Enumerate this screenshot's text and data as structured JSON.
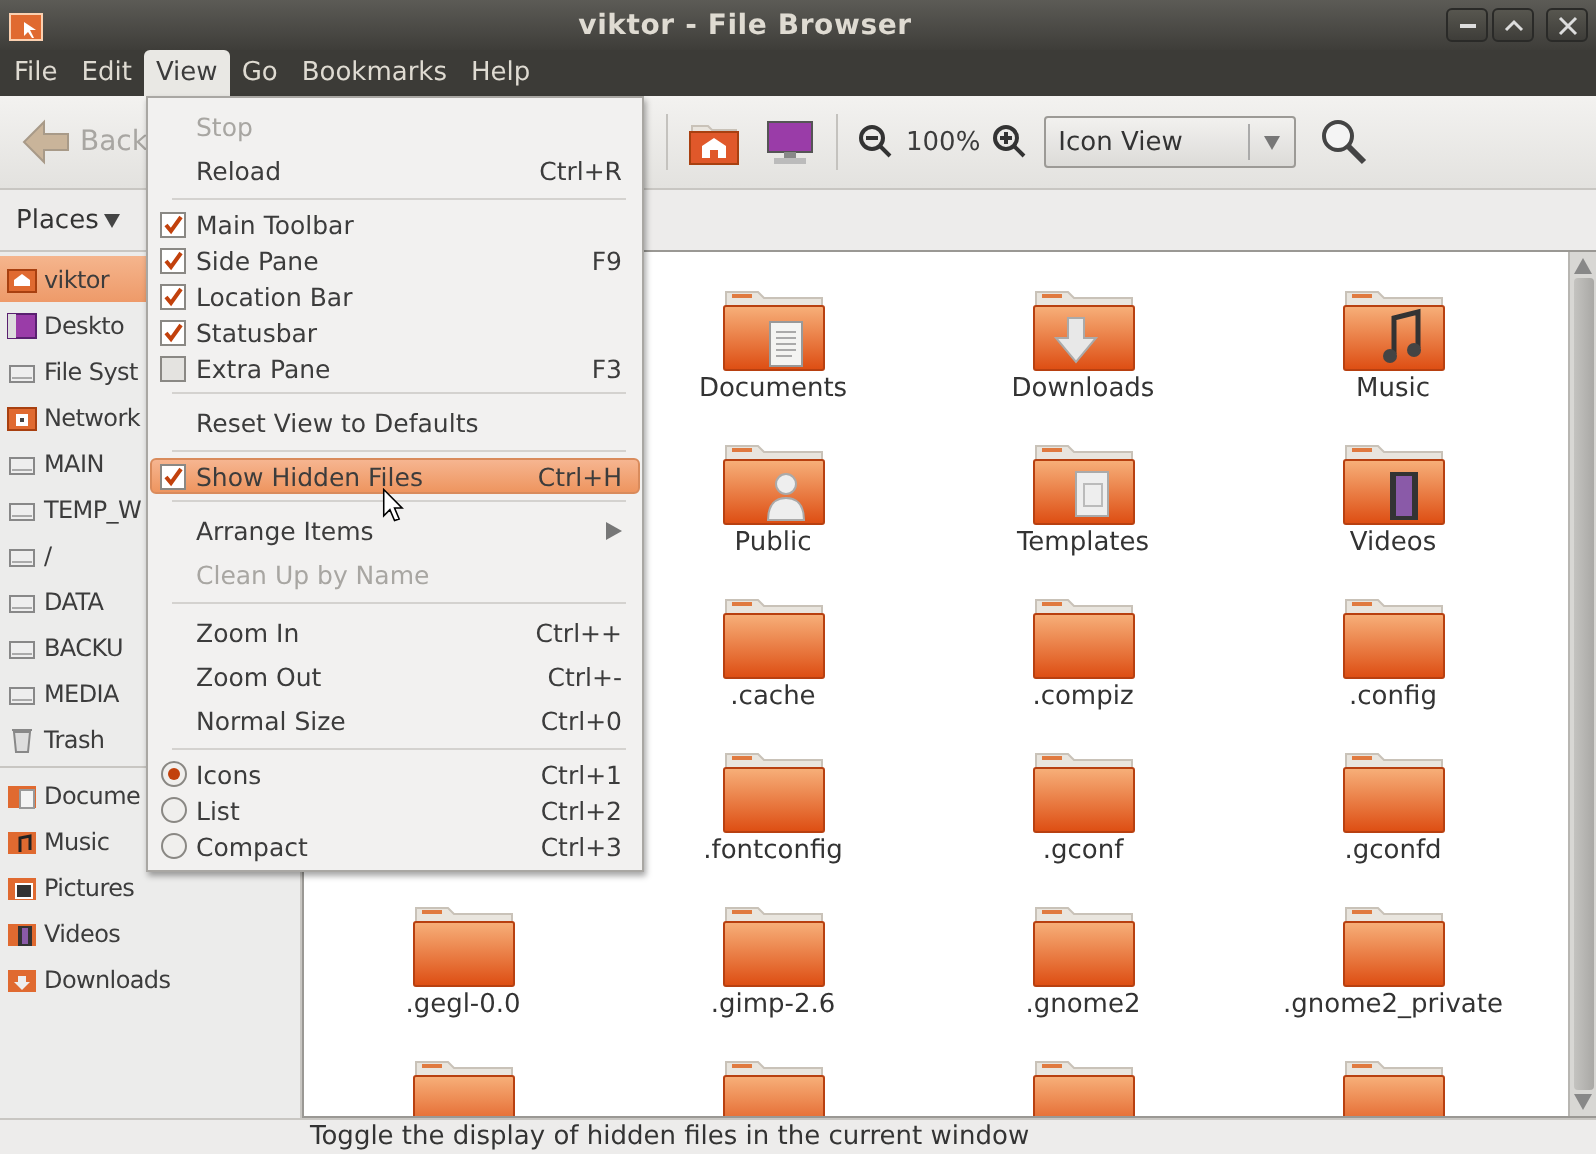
{
  "window": {
    "title": "viktor - File Browser"
  },
  "menubar": [
    {
      "label": "File",
      "selected": false
    },
    {
      "label": "Edit",
      "selected": false
    },
    {
      "label": "View",
      "selected": true
    },
    {
      "label": "Go",
      "selected": false
    },
    {
      "label": "Bookmarks",
      "selected": false
    },
    {
      "label": "Help",
      "selected": false
    }
  ],
  "toolbar": {
    "back": {
      "label": "Back",
      "disabled": true
    },
    "zoom_level": "100%",
    "view_select": "Icon View"
  },
  "location_bar": {
    "places_button": "Places"
  },
  "sidebar": {
    "places": [
      {
        "label": "viktor",
        "kind": "home",
        "selected": true
      },
      {
        "label": "Deskto",
        "kind": "desktop",
        "selected": false
      },
      {
        "label": "File Syst",
        "kind": "drive",
        "selected": false
      },
      {
        "label": "Network",
        "kind": "network",
        "selected": false
      },
      {
        "label": "MAIN",
        "kind": "drive",
        "selected": false
      },
      {
        "label": "TEMP_W",
        "kind": "drive",
        "selected": false
      },
      {
        "label": "/",
        "kind": "drive",
        "selected": false
      },
      {
        "label": "DATA",
        "kind": "drive",
        "selected": false
      },
      {
        "label": "BACKU",
        "kind": "drive",
        "selected": false
      },
      {
        "label": "MEDIA",
        "kind": "drive",
        "selected": false
      },
      {
        "label": "Trash",
        "kind": "trash",
        "selected": false
      }
    ],
    "bookmarks": [
      {
        "label": "Docume",
        "kind": "documents",
        "selected": false
      },
      {
        "label": "Music",
        "kind": "music",
        "selected": false
      },
      {
        "label": "Pictures",
        "kind": "pictures",
        "selected": false
      },
      {
        "label": "Videos",
        "kind": "videos",
        "selected": false
      },
      {
        "label": "Downloads",
        "kind": "downloads",
        "selected": false
      }
    ]
  },
  "files": {
    "rows": [
      {
        "items": [
          {
            "label": "Documents",
            "kind": "documents"
          },
          {
            "label": "Downloads",
            "kind": "downloads"
          },
          {
            "label": "Music",
            "kind": "music"
          }
        ]
      },
      {
        "items": [
          {
            "label": "Public",
            "kind": "public"
          },
          {
            "label": "Templates",
            "kind": "templates"
          },
          {
            "label": "Videos",
            "kind": "videos"
          }
        ]
      },
      {
        "items": [
          {
            "label": ".cache",
            "kind": "plain"
          },
          {
            "label": ".compiz",
            "kind": "plain"
          },
          {
            "label": ".config",
            "kind": "plain"
          }
        ]
      },
      {
        "items": [
          {
            "label": ".fontconfig",
            "kind": "plain"
          },
          {
            "label": ".gconf",
            "kind": "plain"
          },
          {
            "label": ".gconfd",
            "kind": "plain"
          }
        ]
      },
      {
        "items": [
          {
            "label": ".gegl-0.0",
            "kind": "plain"
          },
          {
            "label": ".gimp-2.6",
            "kind": "plain"
          },
          {
            "label": ".gnome2",
            "kind": "plain"
          },
          {
            "label": ".gnome2_private",
            "kind": "plain"
          }
        ]
      },
      {
        "items": [
          {
            "kind": "plain"
          },
          {
            "kind": "plain"
          },
          {
            "kind": "plain"
          },
          {
            "kind": "plain"
          }
        ]
      }
    ]
  },
  "status_bar": "Toggle the display of hidden files in the current window",
  "view_menu": {
    "items": [
      {
        "kind": "plain",
        "label": "Stop",
        "disabled": true,
        "selected": false
      },
      {
        "kind": "plain",
        "label": "Reload",
        "shortcut": "Ctrl+R",
        "disabled": false,
        "selected": false
      },
      {
        "kind": "separator"
      },
      {
        "kind": "check",
        "label": "Main Toolbar",
        "checked": true,
        "disabled": false,
        "selected": false
      },
      {
        "kind": "check",
        "label": "Side Pane",
        "shortcut": "F9",
        "checked": true,
        "disabled": false,
        "selected": false
      },
      {
        "kind": "check",
        "label": "Location Bar",
        "checked": true,
        "disabled": false,
        "selected": false
      },
      {
        "kind": "check",
        "label": "Statusbar",
        "checked": true,
        "disabled": false,
        "selected": false
      },
      {
        "kind": "check",
        "label": "Extra Pane",
        "shortcut": "F3",
        "checked": false,
        "disabled": false,
        "selected": false
      },
      {
        "kind": "separator"
      },
      {
        "kind": "plain",
        "label": "Reset View to Defaults",
        "disabled": false,
        "selected": false
      },
      {
        "kind": "separator"
      },
      {
        "kind": "check",
        "label": "Show Hidden Files",
        "shortcut": "Ctrl+H",
        "checked": true,
        "disabled": false,
        "selected": true
      },
      {
        "kind": "separator"
      },
      {
        "kind": "submenu",
        "label": "Arrange Items",
        "disabled": false,
        "selected": false
      },
      {
        "kind": "plain",
        "label": "Clean Up by Name",
        "disabled": true,
        "selected": false
      },
      {
        "kind": "separator"
      },
      {
        "kind": "plain",
        "label": "Zoom In",
        "shortcut": "Ctrl++",
        "disabled": false,
        "selected": false
      },
      {
        "kind": "plain",
        "label": "Zoom Out",
        "shortcut": "Ctrl+-",
        "disabled": false,
        "selected": false
      },
      {
        "kind": "plain",
        "label": "Normal Size",
        "shortcut": "Ctrl+0",
        "disabled": false,
        "selected": false
      },
      {
        "kind": "separator"
      },
      {
        "kind": "radio",
        "label": "Icons",
        "shortcut": "Ctrl+1",
        "checked": true,
        "disabled": false,
        "selected": false
      },
      {
        "kind": "radio",
        "label": "List",
        "shortcut": "Ctrl+2",
        "checked": false,
        "disabled": false,
        "selected": false
      },
      {
        "kind": "radio",
        "label": "Compact",
        "shortcut": "Ctrl+3",
        "checked": false,
        "disabled": false,
        "selected": false
      }
    ]
  }
}
